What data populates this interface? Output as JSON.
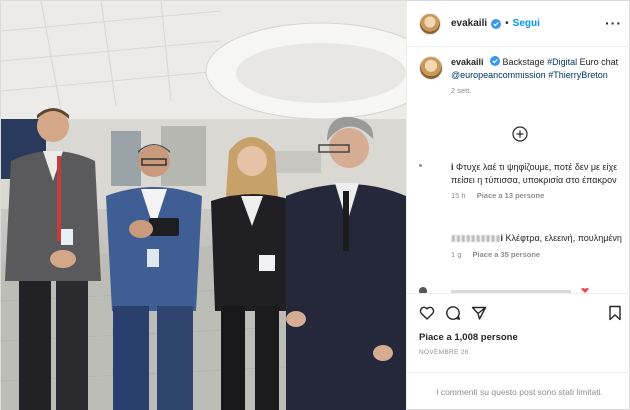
{
  "post": {
    "username": "evakaili",
    "follow_label": "Segui",
    "separator": "•",
    "more_label": "···",
    "caption": {
      "username": "evakaili",
      "text_1": " Backstage ",
      "tag_digital": "#Digital",
      "text_2": " Euro chat ",
      "tag_commission": "@europeancommission",
      "tag_breton": "#ThierryBreton",
      "time": "2 sett."
    }
  },
  "comments": [
    {
      "username": "i",
      "text": " Φτυχε λαέ τι ψηφίζουμε, ποτέ δεν με είχε πείσει η τύπισσα, υποκρισία στο έπακρον",
      "time": "15 h",
      "likes": "Piace a 13 persone"
    },
    {
      "username": "i",
      "text": " Κλέφτρα, ελεεινή, πουλημένη",
      "time": "1 g",
      "likes": "Piace a 35 persone"
    }
  ],
  "footer": {
    "likes": "Piace a 1,008 persone",
    "date": "NOVEMBRE 26",
    "limited": "I commenti su questo post sono stati limitati."
  },
  "icons": [
    "verified-badge-icon",
    "more-options-icon",
    "load-more-icon",
    "heart-icon",
    "comment-icon",
    "share-icon",
    "bookmark-icon"
  ],
  "colors": {
    "link": "#0095f6",
    "tag": "#00376b",
    "muted": "#8e8e8e",
    "verified": "#3897f0"
  }
}
